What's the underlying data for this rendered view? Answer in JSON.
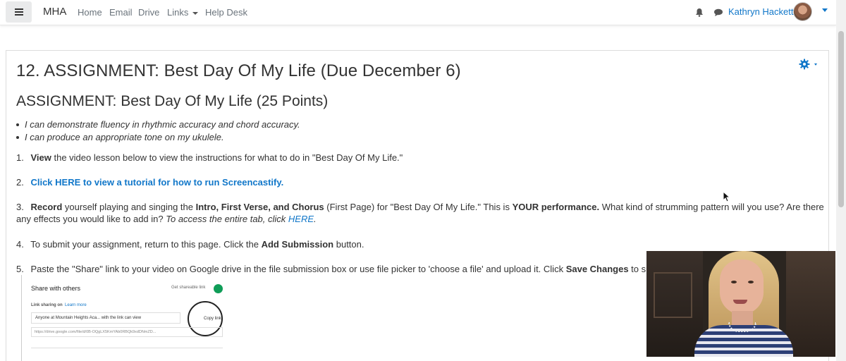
{
  "navbar": {
    "brand": "MHA",
    "links": [
      "Home",
      "Email",
      "Drive",
      "Links",
      "Help Desk"
    ],
    "user_name": "Kathryn Hackett"
  },
  "page": {
    "title": "12. ASSIGNMENT: Best Day Of My Life (Due December 6)",
    "subtitle": "ASSIGNMENT: Best Day Of My Life (25 Points)",
    "objectives": [
      "I can demonstrate fluency in rhythmic accuracy and chord accuracy.",
      "I can produce an appropriate tone on my ukulele."
    ],
    "steps": {
      "s1": {
        "num": "1.",
        "bold": "View",
        "rest": " the video lesson below to view the instructions for what to do in \"Best Day Of My Life.\""
      },
      "s2": {
        "num": "2.",
        "link": "Click HERE to view a tutorial for how to run Screencastify."
      },
      "s3": {
        "num": "3.",
        "bold1": "Record",
        "t1": " yourself playing and singing the ",
        "bold2": "Intro, First Verse, and Chorus",
        "t2": " (First Page) for \"Best Day Of My Life.\"   This is ",
        "bold3": "YOUR performance.",
        "t3": "  What kind of strumming pattern will you use?  Are there any effects you would like to add in? ",
        "italic": "To access the entire tab, click ",
        "link": "HERE",
        "end": "."
      },
      "s4": {
        "num": "4.",
        "t1": "To submit your assignment, return to this page. Click the ",
        "bold": "Add Submission",
        "t2": " button."
      },
      "s5": {
        "num": "5.",
        "t1": "Paste the \"Share\" link to your video on Google drive in the file submission box or use file picker to 'choose a file' and upload it. Click ",
        "bold": "Save Changes",
        "t2": " to submit."
      }
    }
  },
  "share_screenshot": {
    "title": "Share with others",
    "get_link": "Get shareable link",
    "link_sharing_prefix": "Link sharing on",
    "learn_more": "Learn more",
    "row_text": "Anyone at Mountain Heights Aca...   with the link can view",
    "copy_link": "Copy link",
    "url": "https://drive.google.com/file/d/0B-OQgLX5KmYAb0RBQk9xdDNmZD..."
  },
  "icons": {
    "menu": "hamburger-icon",
    "bell": "bell-icon",
    "chat": "chat-icon",
    "gear": "gear-icon",
    "cursor": "mouse-pointer-icon"
  },
  "colors": {
    "link_blue": "#1177c9",
    "text": "#333333",
    "nav_link": "#6a737b"
  }
}
